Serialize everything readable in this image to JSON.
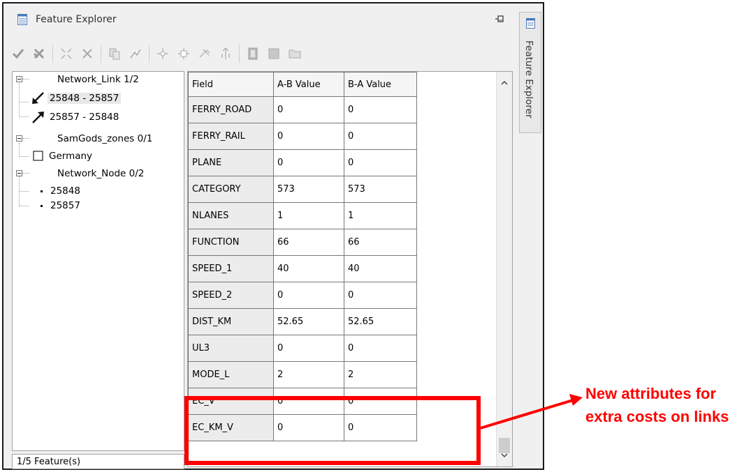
{
  "window": {
    "title": "Feature Explorer",
    "side_tab_label": "Feature Explorer"
  },
  "toolbar": {
    "buttons": [
      "check-icon",
      "cancel-edit-icon",
      "shrink-icon",
      "delete-icon",
      "copy-icon",
      "reshape-icon",
      "add-node-icon",
      "split-node-icon",
      "remove-node-icon",
      "move-node-icon",
      "film-icon",
      "square-icon",
      "folder-icon"
    ]
  },
  "tree": {
    "groups": [
      {
        "label": "Network_Link 1/2",
        "children": [
          "25848 - 25857",
          "25857 - 25848"
        ]
      },
      {
        "label": "SamGods_zones 0/1",
        "children": [
          "Germany"
        ]
      },
      {
        "label": "Network_Node 0/2",
        "children": [
          "25848",
          "25857"
        ]
      }
    ]
  },
  "status": "1/5 Feature(s)",
  "grid": {
    "headers": [
      "Field",
      "A-B Value",
      "B-A Value"
    ],
    "rows": [
      [
        "FERRY_ROAD",
        "0",
        "0"
      ],
      [
        "FERRY_RAIL",
        "0",
        "0"
      ],
      [
        "PLANE",
        "0",
        "0"
      ],
      [
        "CATEGORY",
        "573",
        "573"
      ],
      [
        "NLANES",
        "1",
        "1"
      ],
      [
        "FUNCTION",
        "66",
        "66"
      ],
      [
        "SPEED_1",
        "40",
        "40"
      ],
      [
        "SPEED_2",
        "0",
        "0"
      ],
      [
        "DIST_KM",
        "52.65",
        "52.65"
      ],
      [
        "UL3",
        "0",
        "0"
      ],
      [
        "MODE_L",
        "2",
        "2"
      ],
      [
        "EC_V",
        "0",
        "0"
      ],
      [
        "EC_KM_V",
        "0",
        "0"
      ]
    ]
  },
  "annotation": {
    "line1": "New attributes for",
    "line2": "extra costs on links",
    "color": "#ff0000"
  }
}
